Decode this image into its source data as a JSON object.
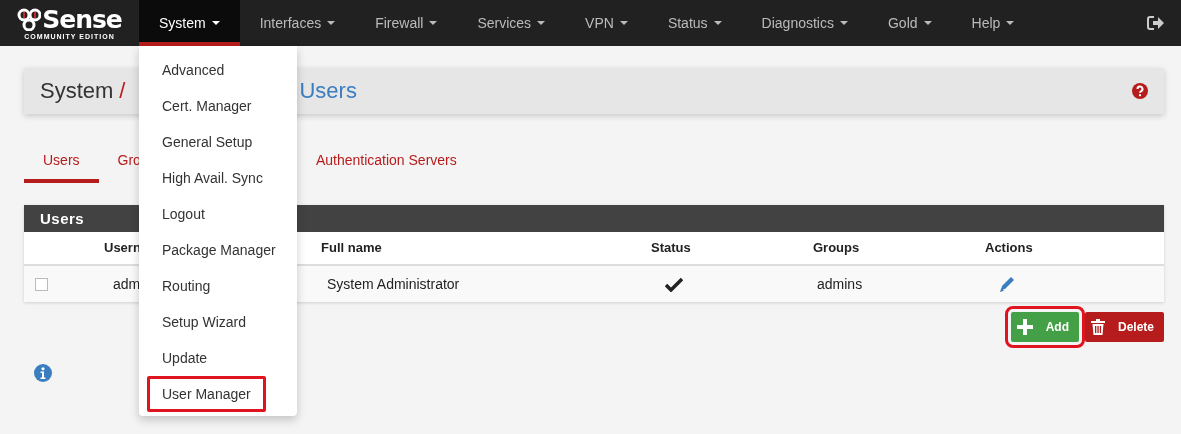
{
  "navbar": {
    "logo": {
      "brand": "Sense",
      "edition": "COMMUNITY EDITION"
    },
    "menus": [
      {
        "label": "System",
        "selected": true
      },
      {
        "label": "Interfaces",
        "selected": false
      },
      {
        "label": "Firewall",
        "selected": false
      },
      {
        "label": "Services",
        "selected": false
      },
      {
        "label": "VPN",
        "selected": false
      },
      {
        "label": "Status",
        "selected": false
      },
      {
        "label": "Diagnostics",
        "selected": false
      },
      {
        "label": "Gold",
        "selected": false
      },
      {
        "label": "Help",
        "selected": false
      }
    ]
  },
  "dropdown": {
    "items": [
      {
        "label": "Advanced",
        "highlighted": false
      },
      {
        "label": "Cert. Manager",
        "highlighted": false
      },
      {
        "label": "General Setup",
        "highlighted": false
      },
      {
        "label": "High Avail. Sync",
        "highlighted": false
      },
      {
        "label": "Logout",
        "highlighted": false
      },
      {
        "label": "Package Manager",
        "highlighted": false
      },
      {
        "label": "Routing",
        "highlighted": false
      },
      {
        "label": "Setup Wizard",
        "highlighted": false
      },
      {
        "label": "Update",
        "highlighted": false
      },
      {
        "label": "User Manager",
        "highlighted": true
      }
    ]
  },
  "breadcrumb": {
    "root": "System",
    "separator": "/",
    "current": "Users"
  },
  "tabs": [
    {
      "label": "Users",
      "selected": true
    },
    {
      "label": "Gro",
      "selected": false
    },
    {
      "label": "Authentication Servers",
      "selected": false
    }
  ],
  "panel": {
    "title": "Users",
    "columns": [
      "Usern",
      "Full name",
      "Status",
      "Groups",
      "Actions"
    ],
    "rows": [
      {
        "checked": false,
        "username": "adm",
        "full_name": "System Administrator",
        "enabled": true,
        "groups": "admins"
      }
    ]
  },
  "buttons": [
    {
      "kind": "add",
      "label": "Add",
      "highlighted": true
    },
    {
      "kind": "delete",
      "label": "Delete",
      "highlighted": false
    }
  ]
}
